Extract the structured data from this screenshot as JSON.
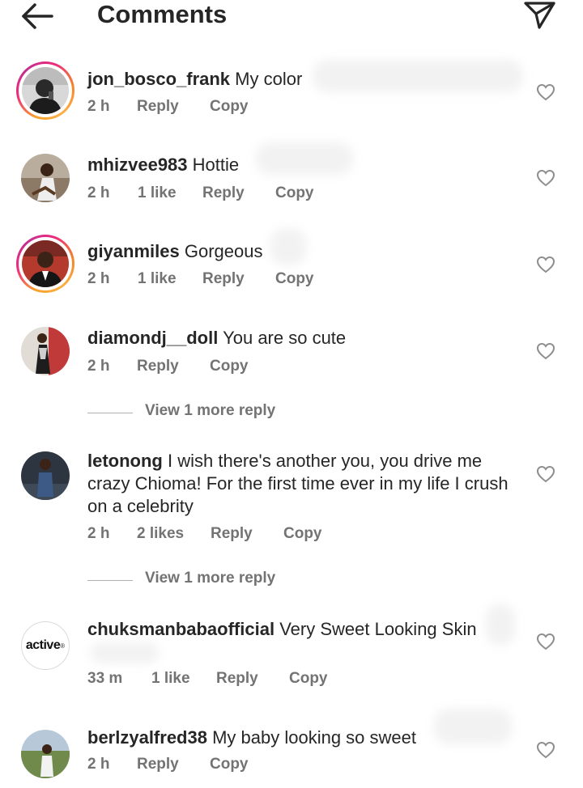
{
  "header": {
    "title": "Comments",
    "back_icon": "arrow-left-icon",
    "send_icon": "paper-plane-icon"
  },
  "comments": [
    {
      "username": "jon_bosco_frank",
      "text": "My color",
      "time": "2 h",
      "likes": "",
      "reply": "Reply",
      "copy": "Copy",
      "story_ring": true
    },
    {
      "username": "mhizvee983",
      "text": "Hottie",
      "time": "2 h",
      "likes": "1 like",
      "reply": "Reply",
      "copy": "Copy",
      "story_ring": false
    },
    {
      "username": "giyanmiles",
      "text": "Gorgeous",
      "time": "2 h",
      "likes": "1 like",
      "reply": "Reply",
      "copy": "Copy",
      "story_ring": true
    },
    {
      "username": "diamondj__doll",
      "text": "You are so cute",
      "time": "2 h",
      "likes": "",
      "reply": "Reply",
      "copy": "Copy",
      "story_ring": false,
      "view_more": "View 1 more reply"
    },
    {
      "username": "letonong",
      "text": "I wish there's another you, you drive me crazy Chioma! For the first time ever in my life I crush on a celebrity",
      "time": "2 h",
      "likes": "2 likes",
      "reply": "Reply",
      "copy": "Copy",
      "story_ring": false,
      "view_more": "View 1 more reply"
    },
    {
      "username": "chuksmanbabaofficial",
      "text": "Very Sweet Looking Skin",
      "time": "33 m",
      "likes": "1 like",
      "reply": "Reply",
      "copy": "Copy",
      "story_ring": false,
      "avatar_text": "active"
    },
    {
      "username": "berlzyalfred38",
      "text": "My baby looking so sweet",
      "time": "2 h",
      "likes": "",
      "reply": "Reply",
      "copy": "Copy",
      "story_ring": false
    }
  ],
  "colors": {
    "text": "#262626",
    "secondary": "#737373",
    "story_ring": [
      "#f9a12b",
      "#ee2a7b",
      "#c42d91"
    ]
  }
}
